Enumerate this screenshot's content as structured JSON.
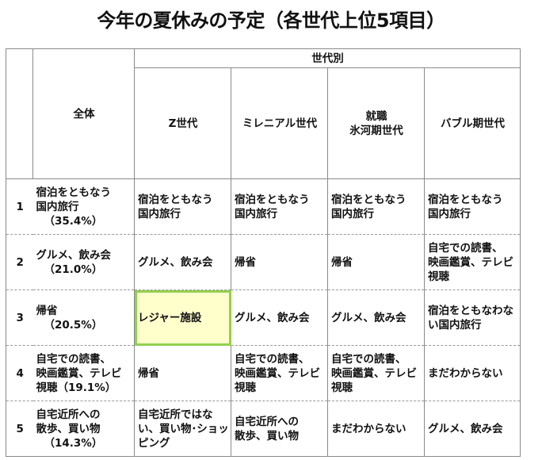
{
  "title": "今年の夏休みの予定（各世代上位5項目）",
  "header": {
    "group": "世代別",
    "overall": "全体",
    "generations": [
      [
        "Z世代"
      ],
      [
        "ミレニアル世代"
      ],
      [
        "就職",
        "氷河期世代"
      ],
      [
        "バブル期世代"
      ]
    ]
  },
  "rows": [
    {
      "rank": "1",
      "overall": [
        "宿泊をともなう",
        "国内旅行",
        "（35.4%）"
      ],
      "gens": [
        [
          "宿泊をともなう",
          "国内旅行"
        ],
        [
          "宿泊をともなう",
          "国内旅行"
        ],
        [
          "宿泊をともなう",
          "国内旅行"
        ],
        [
          "宿泊をともなう",
          "国内旅行"
        ]
      ]
    },
    {
      "rank": "2",
      "overall": [
        "グルメ、飲み会",
        "（21.0%）"
      ],
      "gens": [
        [
          "グルメ、飲み会"
        ],
        [
          "帰省"
        ],
        [
          "帰省"
        ],
        [
          "自宅での読書、",
          "映画鑑賞、テレビ",
          "視聴"
        ]
      ]
    },
    {
      "rank": "3",
      "overall": [
        "帰省",
        "（20.5%）"
      ],
      "gens": [
        [
          "レジャー施設"
        ],
        [
          "グルメ、飲み会"
        ],
        [
          "グルメ、飲み会"
        ],
        [
          "宿泊をともなわな",
          "い国内旅行"
        ]
      ]
    },
    {
      "rank": "4",
      "overall": [
        "自宅での読書、",
        "映画鑑賞、テレビ",
        "視聴（19.1%）"
      ],
      "gens": [
        [
          "帰省"
        ],
        [
          "自宅での読書、",
          "映画鑑賞、テレビ",
          "視聴"
        ],
        [
          "自宅での読書、",
          "映画鑑賞、テレビ",
          "視聴"
        ],
        [
          "まだわからない"
        ]
      ]
    },
    {
      "rank": "5",
      "overall": [
        "自宅近所への",
        "散歩、買い物",
        "（14.3%）"
      ],
      "gens": [
        [
          "自宅近所ではな",
          "い、買い物･ショッ",
          "ピング"
        ],
        [
          "自宅近所への",
          "散歩、買い物"
        ],
        [
          "まだわからない"
        ],
        [
          "グルメ、飲み会"
        ]
      ]
    }
  ],
  "highlight": {
    "row": 3,
    "col": "Z世代",
    "fill": "#ffffcc",
    "border": "#92d050"
  }
}
